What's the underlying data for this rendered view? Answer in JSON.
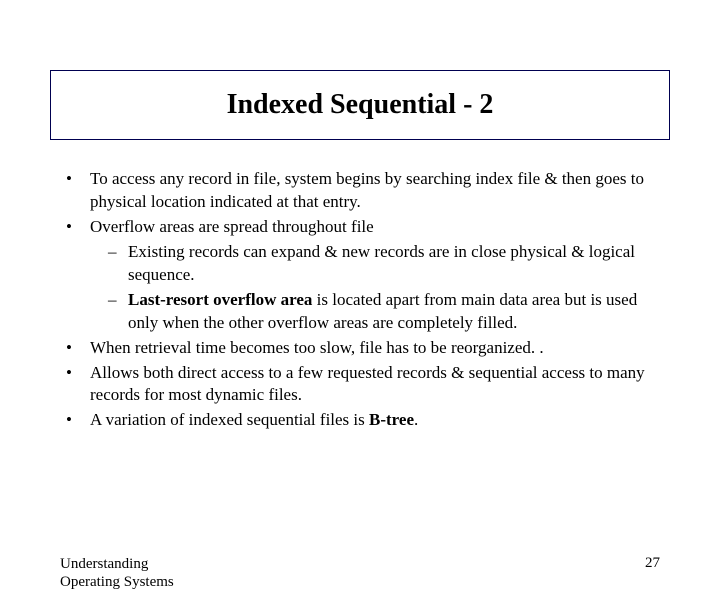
{
  "title": "Indexed Sequential - 2",
  "bullets": {
    "b1": "To access any record in file, system begins by searching index file & then goes to physical location indicated at that entry.",
    "b2": "Overflow areas are spread throughout file",
    "b2_1": "Existing records can expand & new records are in close physical & logical sequence.",
    "b2_2a": "Last-resort overflow area",
    "b2_2b": " is located apart from main data area but is used only when the other overflow areas are completely filled.",
    "b3": "When retrieval time becomes too slow, file has to be reorganized. .",
    "b4": "Allows both direct access to a few requested records & sequential access to many records for most dynamic files.",
    "b5a": "A variation of indexed sequential files is ",
    "b5b": "B-tree",
    "b5c": "."
  },
  "footer": {
    "left_line1": "Understanding",
    "left_line2": "Operating Systems",
    "page": "27"
  }
}
